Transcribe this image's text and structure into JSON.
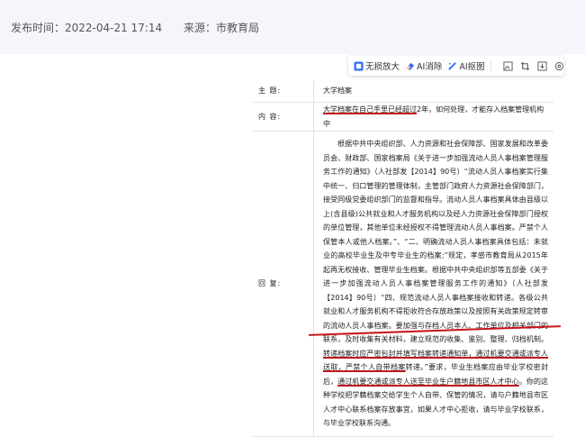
{
  "header": {
    "publish_time": "发布时间：2022-04-21 17:14",
    "source": "来源：市教育局"
  },
  "toolbar": {
    "lossless_zoom": "无损放大",
    "ai_erase": "AI消除",
    "ai_cutout": "AI抠图",
    "icons": [
      "lossless-zoom-icon",
      "ai-erase-icon",
      "ai-cutout-icon",
      "image-edit-icon",
      "crop-icon",
      "download-icon",
      "settings-icon"
    ]
  },
  "document": {
    "subject_label": "主  题:",
    "subject_value": "大学档案",
    "content_label": "内  容:",
    "content_underlined": "大学档案在自己手里已经超过",
    "content_rest": "2年，如何处理，才能存入档案管理机构中",
    "reply_label": "回  复:",
    "reply_part1": "根据中共中央组织部、人力资源和社会保障部、国家发展和改革委员会、财政部、国家档案局《关于进一步加强流动人员人事档案管理服务工作的通知》（人社部发【2014】90号）“流动人员人事档案实行集中统一、归口管理的管理体制，主管部门政府人力资源社会保障部门，接受同级党委组织部门的监督和指导。流动人员人事档案具体由县级以上(含县级)公共就业和人才服务机构以及经人力资源社会保障部门授权的单位管理，其他单位未经授权不得管理流动人员人事档案。严禁个人保管本人或他人档案。”、“二、明确流动人员人事档案具体包括：未就业的高校毕业生及中专毕业生的档案;”规定，孝感市教育局从2015年起再无权接收、管理毕业生档案。根据中共中央组织部等五部委《关于进一步加强流动人员人事档案管理服务工作的通知》（人社部发【2014】90号）“四、规范流动人员人事档案接收和转递。各级公共就业和人才服务机构不得拒收符合存放政策以及按照有关政策规定转审的流动人员人事档案。要加强与存档人员本人、工作单位及相关部门的联系，及时收集有关材料，建立规范的收集、鉴别、整理、归档机制。",
    "reply_underlined1": "转递档案时应严密包封并填写档案转递通知单，通过机要交通或派专人送取，严禁个人自带档案",
    "reply_part2": "转递。”要求，毕业生档案应由毕业学校密封后，",
    "reply_underlined2": "通过机要交通或派专人送至毕业生户籍地县市区人才中心",
    "reply_part3": "。你的这种学校把学籍档案交给学生个人自带、保管的情况，请与户籍地县市区人才中心联系档案存放事宜，如果人才中心拒收，请与毕业学校联系，与毕业学校联系沟通。"
  }
}
